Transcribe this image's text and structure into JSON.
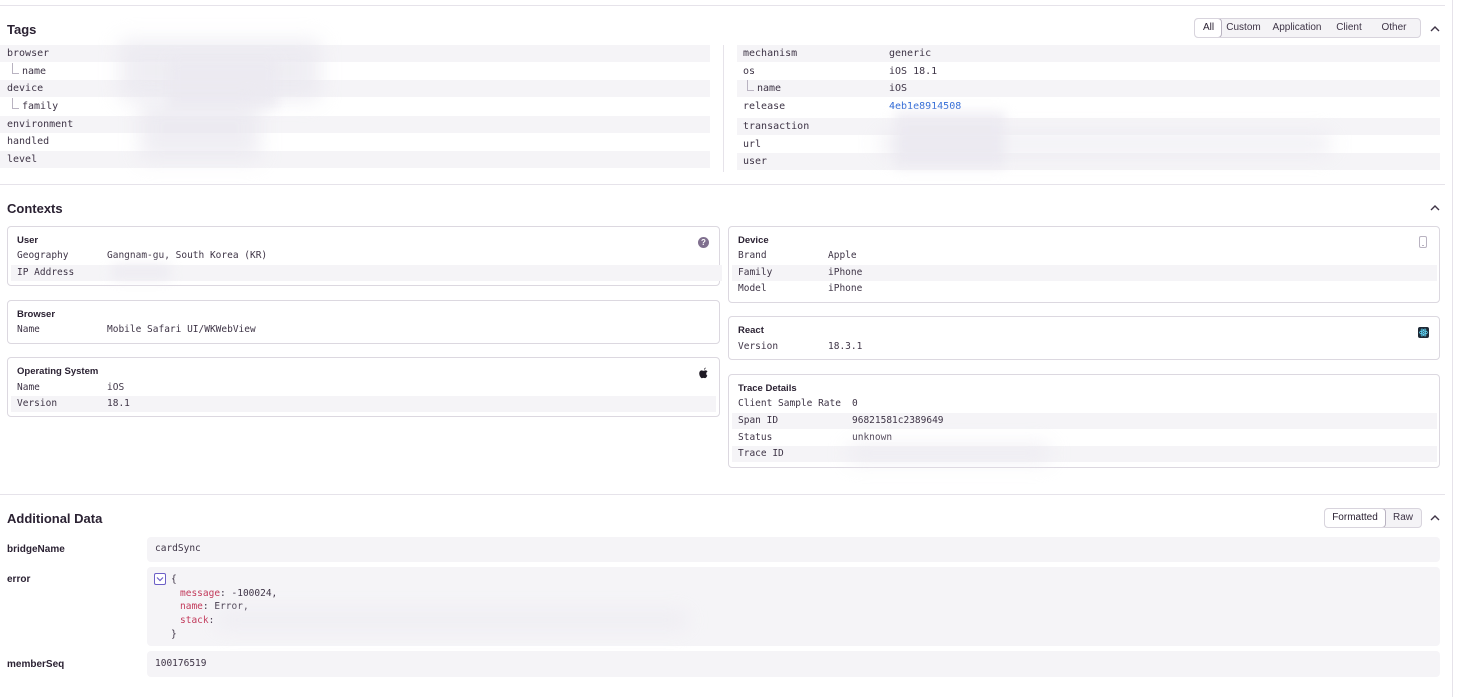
{
  "tags": {
    "title": "Tags",
    "filters": [
      "All",
      "Custom",
      "Application",
      "Client",
      "Other"
    ],
    "active_filter": "All",
    "left": [
      {
        "key": "browser",
        "value": ""
      },
      {
        "key": "name",
        "value": "",
        "child": true
      },
      {
        "key": "device",
        "value": ""
      },
      {
        "key": "family",
        "value": "",
        "child": true
      },
      {
        "key": "environment",
        "value": ""
      },
      {
        "key": "handled",
        "value": ""
      },
      {
        "key": "level",
        "value": ""
      }
    ],
    "right": [
      {
        "key": "mechanism",
        "value": "generic"
      },
      {
        "key": "os",
        "value": "iOS 18.1"
      },
      {
        "key": "name",
        "value": "iOS",
        "child": true
      },
      {
        "key": "release",
        "value": "4eb1e8914508",
        "link": true
      },
      {
        "key": "transaction",
        "value": ""
      },
      {
        "key": "url",
        "value": ""
      },
      {
        "key": "user",
        "value": ""
      }
    ]
  },
  "contexts": {
    "title": "Contexts",
    "user": {
      "title": "User",
      "icon": "help-icon",
      "rows": [
        {
          "k": "Geography",
          "v": "Gangnam-gu, South Korea (KR)"
        },
        {
          "k": "IP Address",
          "v": ""
        }
      ]
    },
    "browser": {
      "title": "Browser",
      "rows": [
        {
          "k": "Name",
          "v": "Mobile Safari UI/WKWebView"
        }
      ]
    },
    "os": {
      "title": "Operating System",
      "icon": "apple-icon",
      "rows": [
        {
          "k": "Name",
          "v": "iOS"
        },
        {
          "k": "Version",
          "v": "18.1"
        }
      ]
    },
    "device": {
      "title": "Device",
      "icon": "phone-icon",
      "rows": [
        {
          "k": "Brand",
          "v": "Apple"
        },
        {
          "k": "Family",
          "v": "iPhone"
        },
        {
          "k": "Model",
          "v": "iPhone"
        }
      ]
    },
    "react": {
      "title": "React",
      "icon": "react-icon",
      "rows": [
        {
          "k": "Version",
          "v": "18.3.1"
        }
      ]
    },
    "trace": {
      "title": "Trace Details",
      "rows": [
        {
          "k": "Client Sample Rate",
          "v": "0"
        },
        {
          "k": "Span ID",
          "v": "96821581c2389649"
        },
        {
          "k": "Status",
          "v": "unknown"
        },
        {
          "k": "Trace ID",
          "v": ""
        }
      ]
    }
  },
  "additional": {
    "title": "Additional Data",
    "view_options": [
      "Formatted",
      "Raw"
    ],
    "active_view": "Formatted",
    "bridgeName": {
      "key": "bridgeName",
      "value": "cardSync"
    },
    "error": {
      "key": "error",
      "open_brace": "{",
      "close_brace": "}",
      "fields": [
        {
          "k": "message",
          "v": "-100024,"
        },
        {
          "k": "name",
          "v": "Error,"
        },
        {
          "k": "stack",
          "v": ""
        }
      ]
    },
    "memberSeq": {
      "key": "memberSeq",
      "value": "100176519"
    }
  }
}
